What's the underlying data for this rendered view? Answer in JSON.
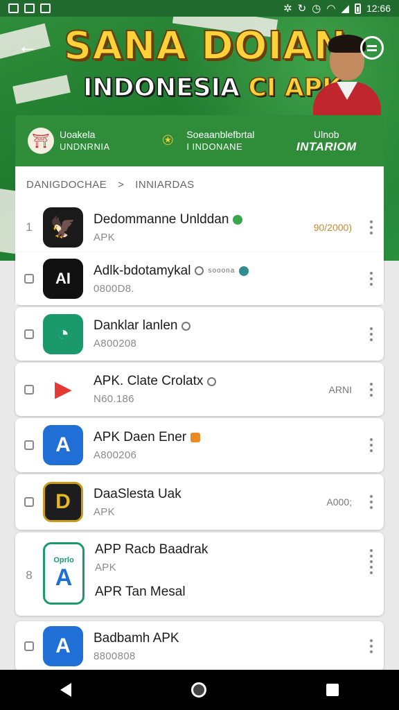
{
  "status_bar": {
    "time": "12:66",
    "left_icons": [
      "image-icon",
      "map-icon",
      "notification-icon"
    ],
    "right_icons": [
      "nfc-icon",
      "sync-icon",
      "alarm-icon",
      "wifi-icon",
      "signal-icon",
      "battery-icon"
    ]
  },
  "header": {
    "title_line1": "SANA DOIAN",
    "title_line2_text": "INDONESIA",
    "title_line2_accent": "CI APK"
  },
  "nav_tabs": [
    {
      "line1": "Uoakela",
      "line2": "UNDNRNIA"
    },
    {
      "line1": "Soeaanblefbrtal",
      "line2": "I INDONANE"
    },
    {
      "line1": "Ulnob",
      "line2": "INTARIOM"
    }
  ],
  "breadcrumb": {
    "root": "DANIGDOCHAE",
    "separator": ">",
    "current": "INNIARDAS"
  },
  "apps": [
    {
      "lead": "1",
      "name": "Dedommanne Unlddan",
      "sub": "APK",
      "meta": "90/2000)",
      "icon_bg": "#1a1a1a",
      "icon_glyph": "🦅",
      "badge": "green"
    },
    {
      "lead": "",
      "name": "Adlk-bdotamykal",
      "sub": "0800D8.",
      "note": "sooona",
      "icon_bg": "#111111",
      "icon_glyph": "AI",
      "badge": "grey"
    },
    {
      "lead": "",
      "name": "Danklar lanlen",
      "sub": "A800208",
      "icon_bg": "#1a9a6b",
      "icon_glyph": "◔",
      "badge": "grey"
    },
    {
      "lead": "",
      "name": "APK. Clate Crolatx",
      "sub": "N60.186",
      "meta": "ARNI",
      "icon_bg": "#ffffff",
      "icon_glyph": "▶",
      "badge": "grey"
    },
    {
      "lead": "",
      "name": "APK Daen Ener",
      "sub": "A800206",
      "icon_bg": "#1f6fd6",
      "icon_glyph": "A",
      "badge": "orange"
    },
    {
      "lead": "",
      "name": "DaaSlesta Uak",
      "sub": "APK",
      "meta": "A000;",
      "icon_bg": "#1d1d1d",
      "icon_glyph": "D",
      "badge": ""
    },
    {
      "lead": "8",
      "name": "APP Racb Baadrak",
      "sub": "APK",
      "sub2": "APR Tan Mesal",
      "icon_bg": "#ffffff",
      "icon_glyph": "A",
      "icon_top_label": "Oprlo",
      "badge": ""
    },
    {
      "lead": "",
      "name": "Badbamh APK",
      "sub": "8800808",
      "icon_bg": "#1f6fd6",
      "icon_glyph": "A",
      "badge": ""
    }
  ],
  "colors": {
    "brand_green": "#2f8d3a",
    "title_yellow": "#ffd23a",
    "card_bg": "#ffffff"
  }
}
